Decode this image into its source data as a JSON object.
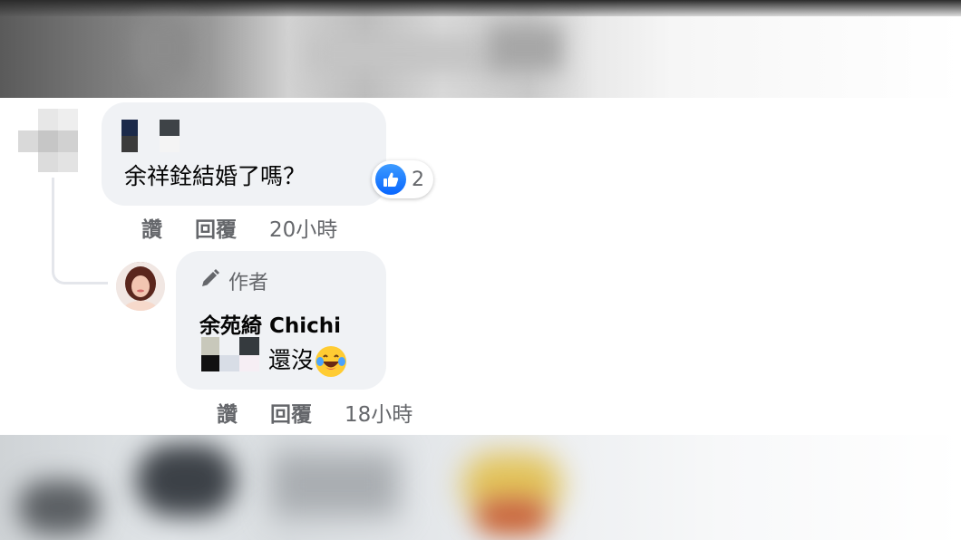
{
  "comments": [
    {
      "text": "余祥銓結婚了嗎？",
      "reaction_count": "2",
      "actions": {
        "like": "讚",
        "reply": "回覆",
        "time": "20小時"
      }
    },
    {
      "badge": "作者",
      "author": "余苑綺 Chichi",
      "text": "還沒",
      "actions": {
        "like": "讚",
        "reply": "回覆",
        "time": "18小時"
      }
    }
  ],
  "icons": {
    "reaction": "like-thumb-icon",
    "badge": "pencil-icon",
    "emoji": "laughing-tears-emoji"
  },
  "colors": {
    "bubble": "#f0f2f5",
    "like_blue": "#0866ff",
    "secondary_text": "#65676b"
  }
}
